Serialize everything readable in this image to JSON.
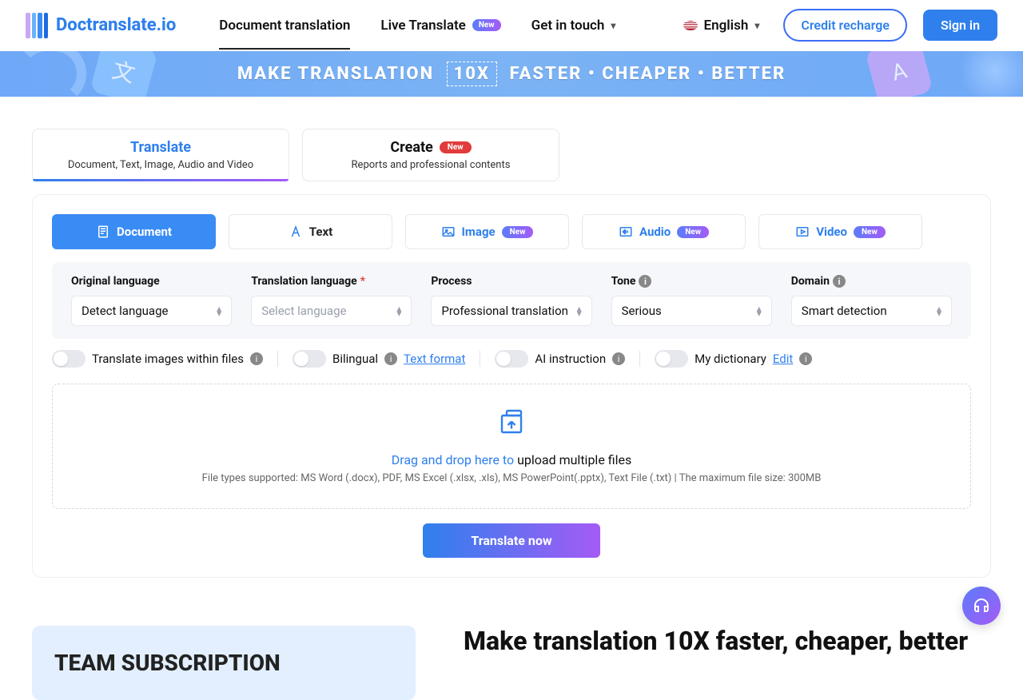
{
  "header": {
    "logo_text": "Doctranslate.io",
    "nav": {
      "doc_translation": "Document translation",
      "live_translate": "Live Translate",
      "live_badge": "New",
      "get_in_touch": "Get in touch"
    },
    "language": "English",
    "credit_btn": "Credit recharge",
    "signin_btn": "Sign in"
  },
  "hero": {
    "pre": "MAKE TRANSLATION",
    "box": "10X",
    "post": "FASTER • CHEAPER • BETTER"
  },
  "top_tabs": {
    "translate": {
      "title": "Translate",
      "sub": "Document, Text, Image, Audio and Video"
    },
    "create": {
      "title": "Create",
      "badge": "New",
      "sub": "Reports and professional contents"
    }
  },
  "type_tabs": {
    "document": "Document",
    "text": "Text",
    "image": "Image",
    "image_badge": "New",
    "audio": "Audio",
    "audio_badge": "New",
    "video": "Video",
    "video_badge": "New"
  },
  "options": {
    "original": {
      "label": "Original language",
      "value": "Detect language"
    },
    "translation": {
      "label": "Translation language",
      "placeholder": "Select language"
    },
    "process": {
      "label": "Process",
      "value": "Professional translation"
    },
    "tone": {
      "label": "Tone",
      "value": "Serious"
    },
    "domain": {
      "label": "Domain",
      "value": "Smart detection"
    }
  },
  "toggles": {
    "images": "Translate images within files",
    "bilingual": "Bilingual",
    "text_format_link": "Text format",
    "ai_instruction": "AI instruction",
    "dictionary": "My dictionary",
    "edit_link": "Edit"
  },
  "dropzone": {
    "line1_b": "Drag and drop here to",
    "line1_rest": " upload multiple files",
    "line2": "File types supported: MS Word (.docx), PDF, MS Excel (.xlsx, .xls), MS PowerPoint(.pptx), Text File (.txt) | The maximum file size: 300MB"
  },
  "cta": "Translate now",
  "bottom": {
    "team_title": "TEAM SUBSCRIPTION",
    "headline": "Make translation 10X faster, cheaper, better"
  }
}
